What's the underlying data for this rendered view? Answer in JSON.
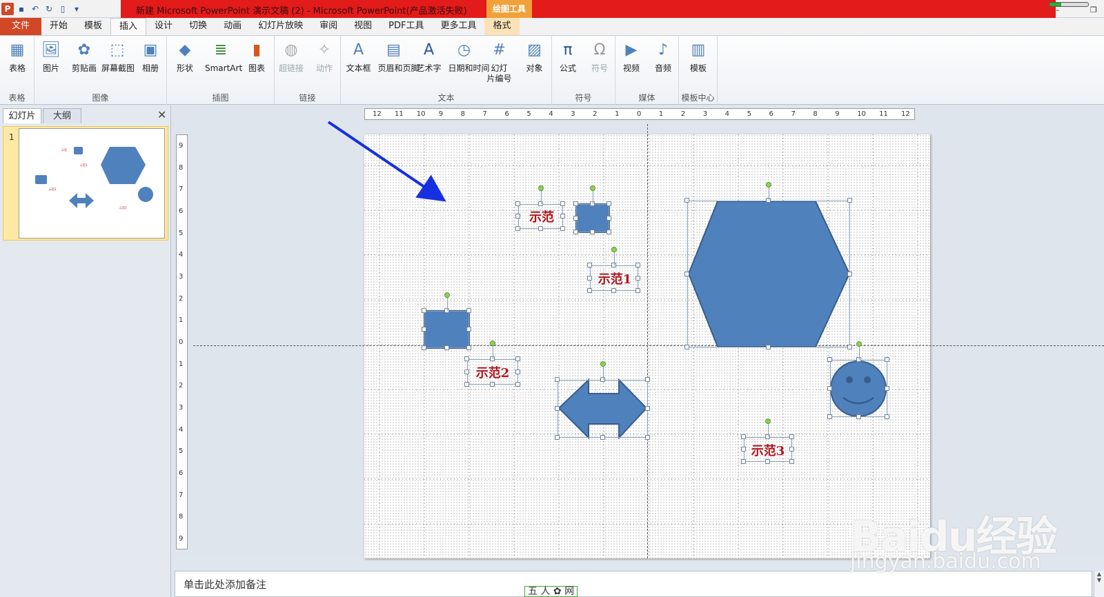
{
  "titlebar": {
    "title": "新建 Microsoft PowerPoint 演示文稿 (2) - Microsoft PowerPoint(产品激活失败)",
    "context_tab": "绘图工具"
  },
  "tabs": [
    "文件",
    "开始",
    "模板",
    "插入",
    "设计",
    "切换",
    "动画",
    "幻灯片放映",
    "审阅",
    "视图",
    "PDF工具",
    "更多工具",
    "格式"
  ],
  "active_tab": "插入",
  "ribbon": {
    "groups": [
      {
        "label": "表格",
        "buttons": [
          {
            "label": "表格",
            "icon": "table-icon"
          }
        ]
      },
      {
        "label": "图像",
        "buttons": [
          {
            "label": "图片",
            "icon": "picture-icon"
          },
          {
            "label": "剪贴画",
            "icon": "clipart-icon"
          },
          {
            "label": "屏幕截图",
            "icon": "screenshot-icon"
          },
          {
            "label": "相册",
            "icon": "album-icon"
          }
        ]
      },
      {
        "label": "插图",
        "buttons": [
          {
            "label": "形状",
            "icon": "shapes-icon"
          },
          {
            "label": "SmartArt",
            "icon": "smartart-icon"
          },
          {
            "label": "图表",
            "icon": "chart-icon"
          }
        ]
      },
      {
        "label": "链接",
        "buttons": [
          {
            "label": "超链接",
            "icon": "hyperlink-icon"
          },
          {
            "label": "动作",
            "icon": "action-icon"
          }
        ]
      },
      {
        "label": "文本",
        "buttons": [
          {
            "label": "文本框",
            "icon": "textbox-icon"
          },
          {
            "label": "页眉和页脚",
            "icon": "header-footer-icon"
          },
          {
            "label": "艺术字",
            "icon": "wordart-icon"
          },
          {
            "label": "日期和时间",
            "icon": "datetime-icon"
          },
          {
            "label": "幻灯\n片编号",
            "icon": "slide-number-icon"
          },
          {
            "label": "对象",
            "icon": "object-icon"
          }
        ]
      },
      {
        "label": "符号",
        "buttons": [
          {
            "label": "公式",
            "icon": "equation-icon"
          },
          {
            "label": "符号",
            "icon": "symbol-icon"
          }
        ]
      },
      {
        "label": "媒体",
        "buttons": [
          {
            "label": "视频",
            "icon": "video-icon"
          },
          {
            "label": "音频",
            "icon": "audio-icon"
          }
        ]
      },
      {
        "label": "模板中心",
        "buttons": [
          {
            "label": "模板",
            "icon": "template-icon"
          }
        ]
      }
    ]
  },
  "leftpanel": {
    "tab_slides": "幻灯片",
    "tab_outline": "大纲",
    "slide_number": "1"
  },
  "slide": {
    "labels": [
      "示范",
      "示范1",
      "示范2",
      "示范3"
    ]
  },
  "ruler": {
    "h_ticks": [
      "12",
      "11",
      "10",
      "9",
      "8",
      "7",
      "6",
      "5",
      "4",
      "3",
      "2",
      "1",
      "0",
      "1",
      "2",
      "3",
      "4",
      "5",
      "6",
      "7",
      "8",
      "9",
      "10",
      "11",
      "12"
    ],
    "v_ticks": [
      "9",
      "8",
      "7",
      "6",
      "5",
      "4",
      "3",
      "2",
      "1",
      "0",
      "1",
      "2",
      "3",
      "4",
      "5",
      "6",
      "7",
      "8",
      "9"
    ]
  },
  "notes": {
    "placeholder": "单击此处添加备注"
  },
  "watermark": {
    "brand": "Baidu经验",
    "url": "jingyan.baidu.com",
    "bottom": "五 人 ✿ 网"
  },
  "colors": {
    "shape_fill": "#4f81bd",
    "shape_stroke": "#385d8a",
    "label_text": "#b0141c",
    "accent_red": "#e31b1b",
    "file_tab": "#d24726"
  }
}
